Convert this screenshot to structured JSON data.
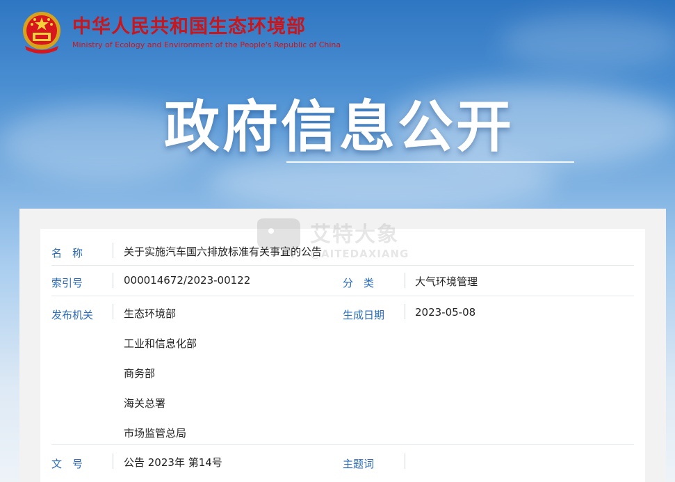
{
  "header": {
    "org_name_cn": "中华人民共和国生态环境部",
    "org_name_en": "Ministry of Ecology and Environment of the People's Republic of China"
  },
  "hero": {
    "title": "政府信息公开"
  },
  "watermark": {
    "cn": "艾特大象",
    "en": "@AITEDAXIANG"
  },
  "info": {
    "name": {
      "label": "名　称",
      "value": "关于实施汽车国六排放标准有关事宜的公告"
    },
    "index": {
      "label": "索引号",
      "value": "000014672/2023-00122"
    },
    "category": {
      "label": "分　类",
      "value": "大气环境管理"
    },
    "issuer": {
      "label": "发布机关",
      "values": [
        "生态环境部",
        "工业和信息化部",
        "商务部",
        "海关总署",
        "市场监管总局"
      ]
    },
    "date": {
      "label": "生成日期",
      "value": "2023-05-08"
    },
    "doc_no": {
      "label": "文　号",
      "value": "公告 2023年 第14号"
    },
    "keywords": {
      "label": "主题词",
      "value": ""
    }
  },
  "colors": {
    "brand_red": "#c8161d",
    "label_blue": "#2a6bb8"
  }
}
